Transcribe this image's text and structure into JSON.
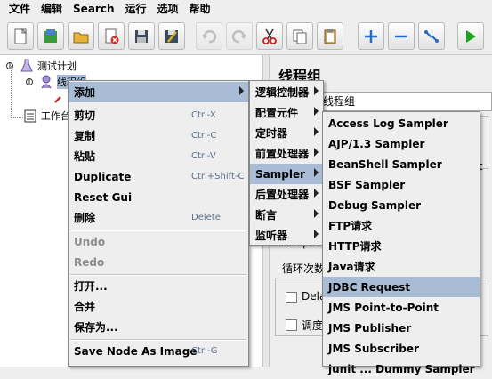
{
  "menubar": [
    "文件",
    "编辑",
    "Search",
    "运行",
    "选项",
    "帮助"
  ],
  "toolbar_icons": [
    "new-icon",
    "templates-icon",
    "open-icon",
    "close-icon",
    "save-icon",
    "save-as-icon",
    "undo-icon",
    "redo-icon",
    "cut-icon",
    "copy-icon",
    "paste-icon",
    "expand-icon",
    "collapse-icon",
    "toggle-icon",
    "start-icon"
  ],
  "tree": {
    "test_plan": "测试计划",
    "thread_group": "线程组",
    "workbench": "工作台"
  },
  "right_panel": {
    "title": "线程组",
    "name_value": "线程组",
    "clip_rt": "rt",
    "clip_ramp": "Ramp-Up",
    "loop_label": "循环次数",
    "delay_label": "Dela",
    "scheduler_label": "调度"
  },
  "context_menu": [
    {
      "label": "添加",
      "shortcut": "",
      "submenu": true,
      "selected": true
    },
    {
      "label": "剪切",
      "shortcut": "Ctrl-X"
    },
    {
      "label": "复制",
      "shortcut": "Ctrl-C"
    },
    {
      "label": "粘贴",
      "shortcut": "Ctrl-V"
    },
    {
      "label": "Duplicate",
      "shortcut": "Ctrl+Shift-C"
    },
    {
      "label": "Reset Gui",
      "shortcut": ""
    },
    {
      "label": "删除",
      "shortcut": "Delete"
    },
    {
      "label": "Undo",
      "shortcut": "",
      "disabled": true
    },
    {
      "label": "Redo",
      "shortcut": "",
      "disabled": true
    },
    {
      "label": "打开...",
      "shortcut": ""
    },
    {
      "label": "合并",
      "shortcut": ""
    },
    {
      "label": "保存为...",
      "shortcut": ""
    },
    {
      "label": "Save Node As Image",
      "shortcut": "Ctrl-G"
    }
  ],
  "add_submenu": [
    {
      "label": "逻辑控制器"
    },
    {
      "label": "配置元件"
    },
    {
      "label": "定时器"
    },
    {
      "label": "前置处理器"
    },
    {
      "label": "Sampler",
      "selected": true
    },
    {
      "label": "后置处理器"
    },
    {
      "label": "断言"
    },
    {
      "label": "监听器"
    }
  ],
  "sampler_submenu": [
    {
      "label": "Access Log Sampler"
    },
    {
      "label": "AJP/1.3 Sampler"
    },
    {
      "label": "BeanShell Sampler"
    },
    {
      "label": "BSF Sampler"
    },
    {
      "label": "Debug Sampler"
    },
    {
      "label": "FTP请求"
    },
    {
      "label": "HTTP请求"
    },
    {
      "label": "Java请求"
    },
    {
      "label": "JDBC Request",
      "selected": true
    },
    {
      "label": "JMS Point-to-Point"
    },
    {
      "label": "JMS Publisher"
    },
    {
      "label": "JMS Subscriber"
    },
    {
      "label": "junit ... Dummy Sampler"
    }
  ]
}
